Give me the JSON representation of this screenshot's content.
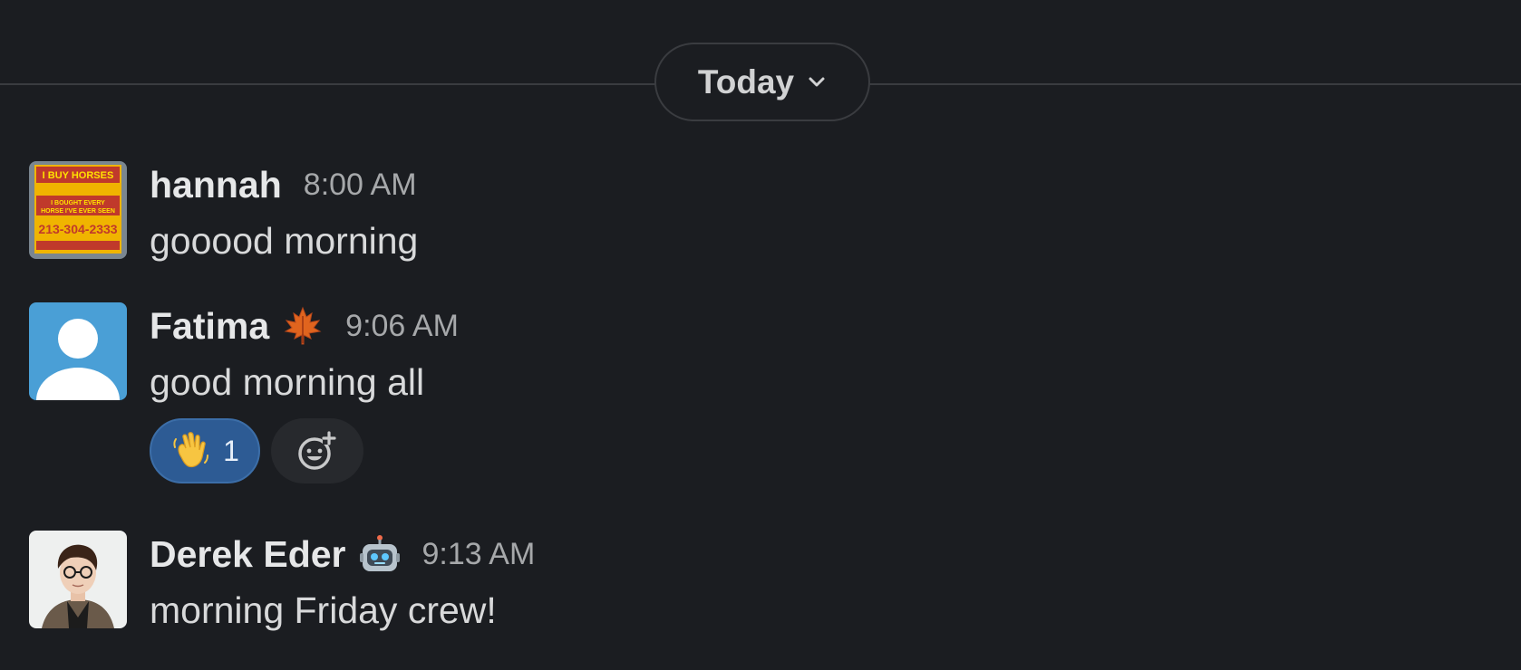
{
  "divider": {
    "date_label": "Today"
  },
  "messages": [
    {
      "author": "hannah",
      "time": "8:00 AM",
      "text": "gooood morning",
      "status_emoji": ""
    },
    {
      "author": "Fatima",
      "time": "9:06 AM",
      "text": "good morning all",
      "status_emoji": "maple-leaf-icon",
      "reactions": [
        {
          "emoji": "waving-hand-icon",
          "count": "1"
        }
      ]
    },
    {
      "author": "Derek Eder",
      "time": "9:13 AM",
      "text": "morning Friday crew!",
      "status_emoji": "robot-icon"
    }
  ],
  "avatar_sign": {
    "headline": "I BUY HORSES",
    "line1": "I BOUGHT EVERY",
    "line2": "HORSE I'VE EVER SEEN",
    "phone": "213-304-2333"
  },
  "colors": {
    "background": "#1b1d21",
    "reaction_active": "#2d5b94",
    "avatar_default": "#4a9fd6"
  }
}
